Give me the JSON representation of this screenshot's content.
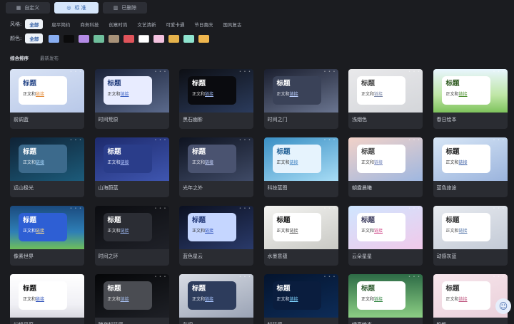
{
  "tabs": [
    {
      "icon": "grid-icon",
      "glyph": "▦",
      "label": "自定义",
      "active": false
    },
    {
      "icon": "standard-icon",
      "glyph": "◎",
      "label": "标 准",
      "active": true
    },
    {
      "icon": "trash-icon",
      "glyph": "▥",
      "label": "已删除",
      "active": false
    }
  ],
  "styles": {
    "label": "风格:",
    "items": [
      "全部",
      "扁平简约",
      "商务科技",
      "创意时尚",
      "文艺清新",
      "可爱卡通",
      "节日喜庆",
      "国风复古"
    ]
  },
  "colors": {
    "label": "颜色:",
    "all_label": "全部",
    "swatches": [
      "#89aef2",
      "#0b0b0c",
      "#b48be6",
      "#6fbf9c",
      "#a89279",
      "#e0545b",
      "#ffffff",
      "#f3c2df",
      "#e5b24b",
      "#8fe4cf",
      "#efb64e"
    ]
  },
  "sort": {
    "primary": "综合排序",
    "secondary": "最新发布"
  },
  "card_text": {
    "title": "标题",
    "body": "正文和",
    "link": "链接"
  },
  "templates": [
    {
      "name": "前调蓝",
      "bg": "linear-gradient(160deg,#d9e3f5,#b8c8e8)",
      "inner": "#ffffff",
      "title_color": "#2b4a8a",
      "text_color": "#333",
      "link_color": "#e38b3a"
    },
    {
      "name": "时间荒原",
      "bg": "linear-gradient(160deg,#1a2238,#5b6a8c)",
      "inner": "#e8ecff",
      "title_color": "#1f3a7a",
      "text_color": "#333",
      "link_color": "#3d62c4"
    },
    {
      "name": "黑石幽影",
      "bg": "linear-gradient(160deg,#0d0f14,#2b3b5c)",
      "inner": "#0a0b0f",
      "title_color": "#ffffff",
      "text_color": "#dcdcdc",
      "link_color": "#9fb8f0"
    },
    {
      "name": "时间之门",
      "bg": "linear-gradient(160deg,#1a1e2e,#6a7590)",
      "inner": "#3a4258",
      "title_color": "#ffffff",
      "text_color": "#e4e6ee",
      "link_color": "#bcd0ff"
    },
    {
      "name": "浅烟色",
      "bg": "linear-gradient(160deg,#e9e9eb,#d4d6da)",
      "inner": "#ffffff",
      "title_color": "#444",
      "text_color": "#444",
      "link_color": "#7c88a8"
    },
    {
      "name": "春日绘本",
      "bg": "linear-gradient(180deg,#e9f6ff 0%,#bfe6a6 60%,#7ec35c 100%)",
      "inner": "#ffffff",
      "title_color": "#2e5a1f",
      "text_color": "#333",
      "link_color": "#4c8f2e"
    },
    {
      "name": "远山极光",
      "bg": "linear-gradient(160deg,#0f2235,#1c5b7a)",
      "inner": "#3c6a8c",
      "title_color": "#ffffff",
      "text_color": "#e8f1f8",
      "link_color": "#a8d8ff"
    },
    {
      "name": "山海蔚蓝",
      "bg": "linear-gradient(160deg,#1d2a6c,#3f56b0)",
      "inner": "#2a3d8a",
      "title_color": "#ffffff",
      "text_color": "#e8ecff",
      "link_color": "#b0c4ff"
    },
    {
      "name": "光年之外",
      "bg": "linear-gradient(160deg,#0e1320,#3f4a66)",
      "inner": "#4a5370",
      "title_color": "#ffffff",
      "text_color": "#e4e6ee",
      "link_color": "#c6d4ff"
    },
    {
      "name": "科技蓝图",
      "bg": "linear-gradient(160deg,#3a8fc4,#a7dcf5)",
      "inner": "#e6f3fd",
      "title_color": "#1e5e94",
      "text_color": "#333",
      "link_color": "#3b7fc0"
    },
    {
      "name": "朝露晨曦",
      "bg": "linear-gradient(160deg,#f2d2c8,#9fb7e0)",
      "inner": "#ffffff",
      "title_color": "#444",
      "text_color": "#444",
      "link_color": "#6d7fb8"
    },
    {
      "name": "蓝色旅途",
      "bg": "linear-gradient(160deg,#d7e6f6,#9bb4dd)",
      "inner": "#ffffff",
      "title_color": "#222",
      "text_color": "#333",
      "link_color": "#4466aa"
    },
    {
      "name": "像素世界",
      "bg": "linear-gradient(180deg,#1b4a7e 0%,#2e7fb6 60%,#6fbf5a 100%)",
      "inner": "#2e5fd4",
      "title_color": "#ffffff",
      "text_color": "#ffffff",
      "link_color": "#ffe08a"
    },
    {
      "name": "时间之环",
      "bg": "linear-gradient(160deg,#0b0c10,#1f2128)",
      "inner": "#2b2d34",
      "title_color": "#ffffff",
      "text_color": "#dfe1e6",
      "link_color": "#9bb6f0"
    },
    {
      "name": "蓝色星云",
      "bg": "linear-gradient(160deg,#0b1020,#2a3a6a)",
      "inner": "#c5d6ff",
      "title_color": "#1e3475",
      "text_color": "#333",
      "link_color": "#3355bb"
    },
    {
      "name": "水墨意蕴",
      "bg": "linear-gradient(160deg,#f4f4f2,#c9c9c4)",
      "inner": "#ffffff",
      "title_color": "#111",
      "text_color": "#333",
      "link_color": "#555"
    },
    {
      "name": "云朵星星",
      "bg": "linear-gradient(160deg,#cfe6ff,#f1c9ea)",
      "inner": "#ffffff",
      "title_color": "#3a3a5c",
      "text_color": "#444",
      "link_color": "#d04a8a"
    },
    {
      "name": "动感灰蓝",
      "bg": "linear-gradient(160deg,#e8ebf0,#c3cad6)",
      "inner": "#ffffff",
      "title_color": "#333",
      "text_color": "#444",
      "link_color": "#5577aa"
    },
    {
      "name": "幻境平原",
      "bg": "linear-gradient(180deg,#ffffff 0%,#f0f0f5 70%,#d9d9e0 100%)",
      "inner": "#ffffff",
      "title_color": "#111",
      "text_color": "#333",
      "link_color": "#3355bb"
    },
    {
      "name": "暗夜科技感",
      "bg": "linear-gradient(160deg,#050608,#1e2026)",
      "inner": "#4a4c52",
      "title_color": "#ffffff",
      "text_color": "#e0e0e0",
      "link_color": "#a6bff0"
    },
    {
      "name": "灰调",
      "bg": "linear-gradient(160deg,#d8dce4,#9aa3b5)",
      "inner": "#2d3c5c",
      "title_color": "#ffffff",
      "text_color": "#e6eaf2",
      "link_color": "#a8c4ff"
    },
    {
      "name": "科技感",
      "bg": "linear-gradient(160deg,#04142e,#0d2c58)",
      "inner": "#0a1d3e",
      "title_color": "#ffffff",
      "text_color": "#dfe8f6",
      "link_color": "#7fd4ff"
    },
    {
      "name": "绿意绘本",
      "bg": "linear-gradient(180deg,#2d6b46,#8ccf84)",
      "inner": "#ffffff",
      "title_color": "#2e5a2f",
      "text_color": "#333",
      "link_color": "#3a8a4a"
    },
    {
      "name": "粉韵",
      "bg": "linear-gradient(160deg,#f7e6ec,#ead0da)",
      "inner": "#ffffff",
      "title_color": "#333",
      "text_color": "#444",
      "link_color": "#c05a82"
    }
  ]
}
